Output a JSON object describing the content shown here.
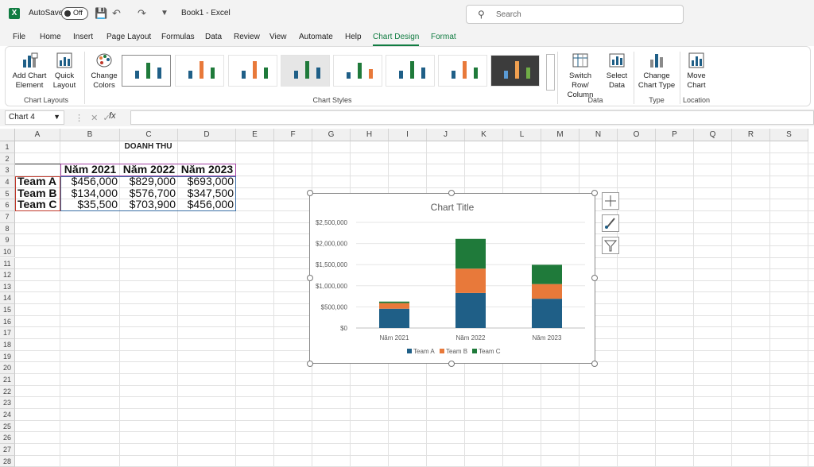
{
  "titlebar": {
    "autosave_label": "AutoSave",
    "autosave_state": "Off",
    "doc_title": "Book1 - Excel",
    "search_placeholder": "Search"
  },
  "menu": {
    "tabs": [
      "File",
      "Home",
      "Insert",
      "Page Layout",
      "Formulas",
      "Data",
      "Review",
      "View",
      "Automate",
      "Help",
      "Chart Design",
      "Format"
    ],
    "active": "Chart Design"
  },
  "ribbon": {
    "add_chart_element": [
      "Add Chart",
      "Element"
    ],
    "quick_layout": [
      "Quick",
      "Layout"
    ],
    "change_colors": [
      "Change",
      "Colors"
    ],
    "switch_row_col": [
      "Switch Row/",
      "Column"
    ],
    "select_data": [
      "Select",
      "Data"
    ],
    "change_chart_type": [
      "Change",
      "Chart Type"
    ],
    "move_chart": [
      "Move",
      "Chart"
    ],
    "groups": {
      "chart_layouts": "Chart Layouts",
      "chart_styles": "Chart Styles",
      "data": "Data",
      "type": "Type",
      "location": "Location"
    }
  },
  "formula_bar": {
    "name_box": "Chart 4",
    "fx": "fx",
    "value": ""
  },
  "sheet": {
    "columns": [
      "A",
      "B",
      "C",
      "D",
      "E",
      "F",
      "G",
      "H",
      "I",
      "J",
      "K",
      "L",
      "M",
      "N",
      "O",
      "P",
      "Q",
      "R",
      "S"
    ],
    "rows": [
      "1",
      "2",
      "3",
      "4",
      "5",
      "6",
      "7",
      "8",
      "9",
      "10",
      "11",
      "12",
      "13",
      "14",
      "15",
      "16",
      "17",
      "18",
      "19",
      "20",
      "21",
      "22",
      "23",
      "24",
      "25",
      "26",
      "27",
      "28"
    ],
    "title": "DOANH THU",
    "headers": [
      "Năm 2021",
      "Năm 2022",
      "Năm 2023"
    ],
    "table": [
      {
        "team": "Team A",
        "values": [
          "$456,000",
          "$829,000",
          "$693,000"
        ]
      },
      {
        "team": "Team B",
        "values": [
          "$134,000",
          "$576,700",
          "$347,500"
        ]
      },
      {
        "team": "Team C",
        "values": [
          "$35,500",
          "$703,900",
          "$456,000"
        ]
      }
    ]
  },
  "chart_data": {
    "type": "bar",
    "stacked": true,
    "title": "Chart Title",
    "categories": [
      "Năm 2021",
      "Năm 2022",
      "Năm 2023"
    ],
    "series": [
      {
        "name": "Team A",
        "values": [
          456000,
          829000,
          693000
        ],
        "color": "#1f5f87"
      },
      {
        "name": "Team B",
        "values": [
          134000,
          576700,
          347500
        ],
        "color": "#e8793a"
      },
      {
        "name": "Team C",
        "values": [
          35500,
          703900,
          456000
        ],
        "color": "#1f7a3a"
      }
    ],
    "ylim": [
      0,
      2500000
    ],
    "yticks": [
      "$0",
      "$500,000",
      "$1,000,000",
      "$1,500,000",
      "$2,000,000",
      "$2,500,000"
    ],
    "grid": true,
    "legend": "bottom"
  },
  "colors": {
    "accent": "#107c41"
  }
}
